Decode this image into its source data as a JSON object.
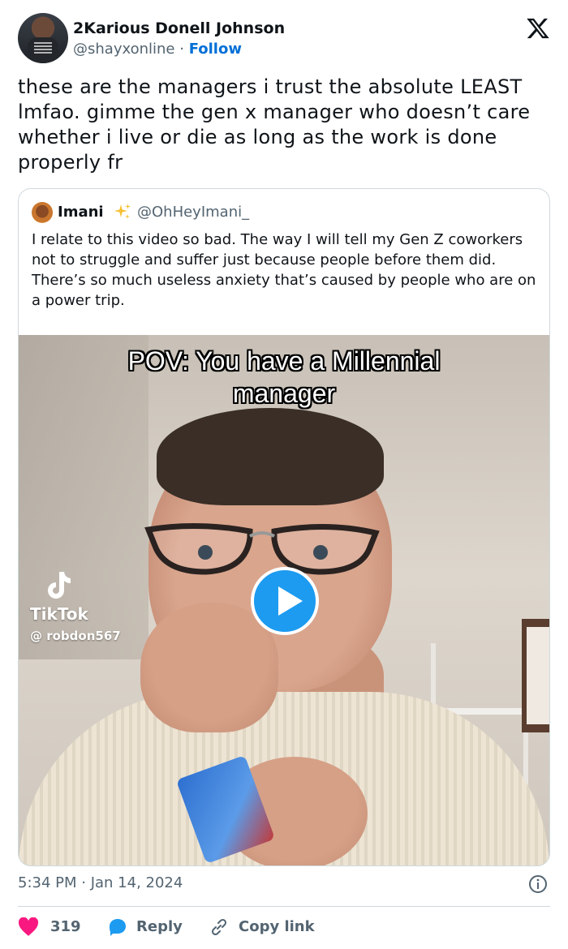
{
  "author": {
    "name": "2Karious Donell Johnson",
    "handle": "@shayxonline",
    "separator": "·",
    "follow_label": "Follow"
  },
  "tweet_text": "these are the managers i trust the absolute LEAST lmfao. gimme the gen x manager who doesn’t care whether i live or die as long as the work is done properly fr",
  "quote": {
    "name": "Imani",
    "handle": "@OhHeyImani_",
    "text": "I relate to this video so bad. The way I will tell my Gen Z coworkers not to struggle and suffer just because people before them did. There’s so much useless anxiety that’s caused by people who are on a power trip.",
    "media": {
      "caption_line1": "POV: You have a Millennial",
      "caption_line2": "manager",
      "watermark_brand": "TikTok",
      "watermark_user": "@ robdon567"
    }
  },
  "timestamp": "5:34 PM · Jan 14, 2024",
  "actions": {
    "like_count": "319",
    "reply_label": "Reply",
    "copy_link_label": "Copy link"
  },
  "colors": {
    "accent": "#1d9bf0",
    "follow": "#006fd6",
    "like": "#f91880",
    "muted": "#536471"
  },
  "icons": [
    "x-logo-icon",
    "sparkles-icon",
    "tiktok-icon",
    "play-icon",
    "info-icon",
    "heart-icon",
    "reply-bubble-icon",
    "link-icon"
  ]
}
